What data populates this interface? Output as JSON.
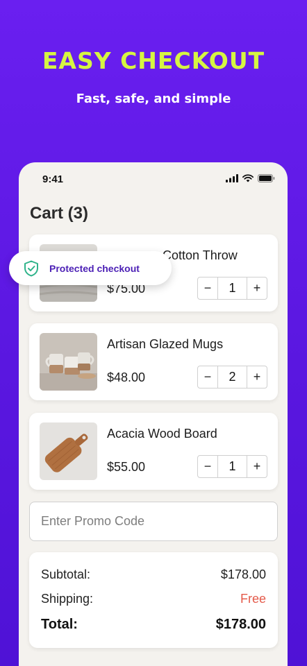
{
  "hero": {
    "title": "EASY CHECKOUT",
    "subtitle": "Fast, safe, and simple"
  },
  "status_bar": {
    "time": "9:41",
    "icons": [
      "signal-icon",
      "wifi-icon",
      "battery-icon"
    ]
  },
  "cart": {
    "title": "Cart (3)",
    "items": [
      {
        "name": "Cozy Knit Cotton Throw",
        "visible_name": "Cotton Throw",
        "price": "$75.00",
        "quantity": "1",
        "image": "throw-blanket-image"
      },
      {
        "name": "Artisan Glazed Mugs",
        "price": "$48.00",
        "quantity": "2",
        "image": "glazed-mugs-image"
      },
      {
        "name": "Acacia Wood Board",
        "price": "$55.00",
        "quantity": "1",
        "image": "wood-board-image"
      }
    ],
    "minus_label": "−",
    "plus_label": "+"
  },
  "promo": {
    "placeholder": "Enter Promo Code",
    "value": ""
  },
  "summary": {
    "subtotal_label": "Subtotal:",
    "subtotal_value": "$178.00",
    "shipping_label": "Shipping:",
    "shipping_value": "Free",
    "total_label": "Total:",
    "total_value": "$178.00"
  },
  "badge": {
    "label": "Protected checkout",
    "icon": "shield-check-icon"
  },
  "colors": {
    "background": "#5a17e0",
    "title_accent": "#d6f542",
    "free_text": "#e45a4a",
    "badge_text": "#4b1fb5",
    "shield": "#2fb38a"
  }
}
